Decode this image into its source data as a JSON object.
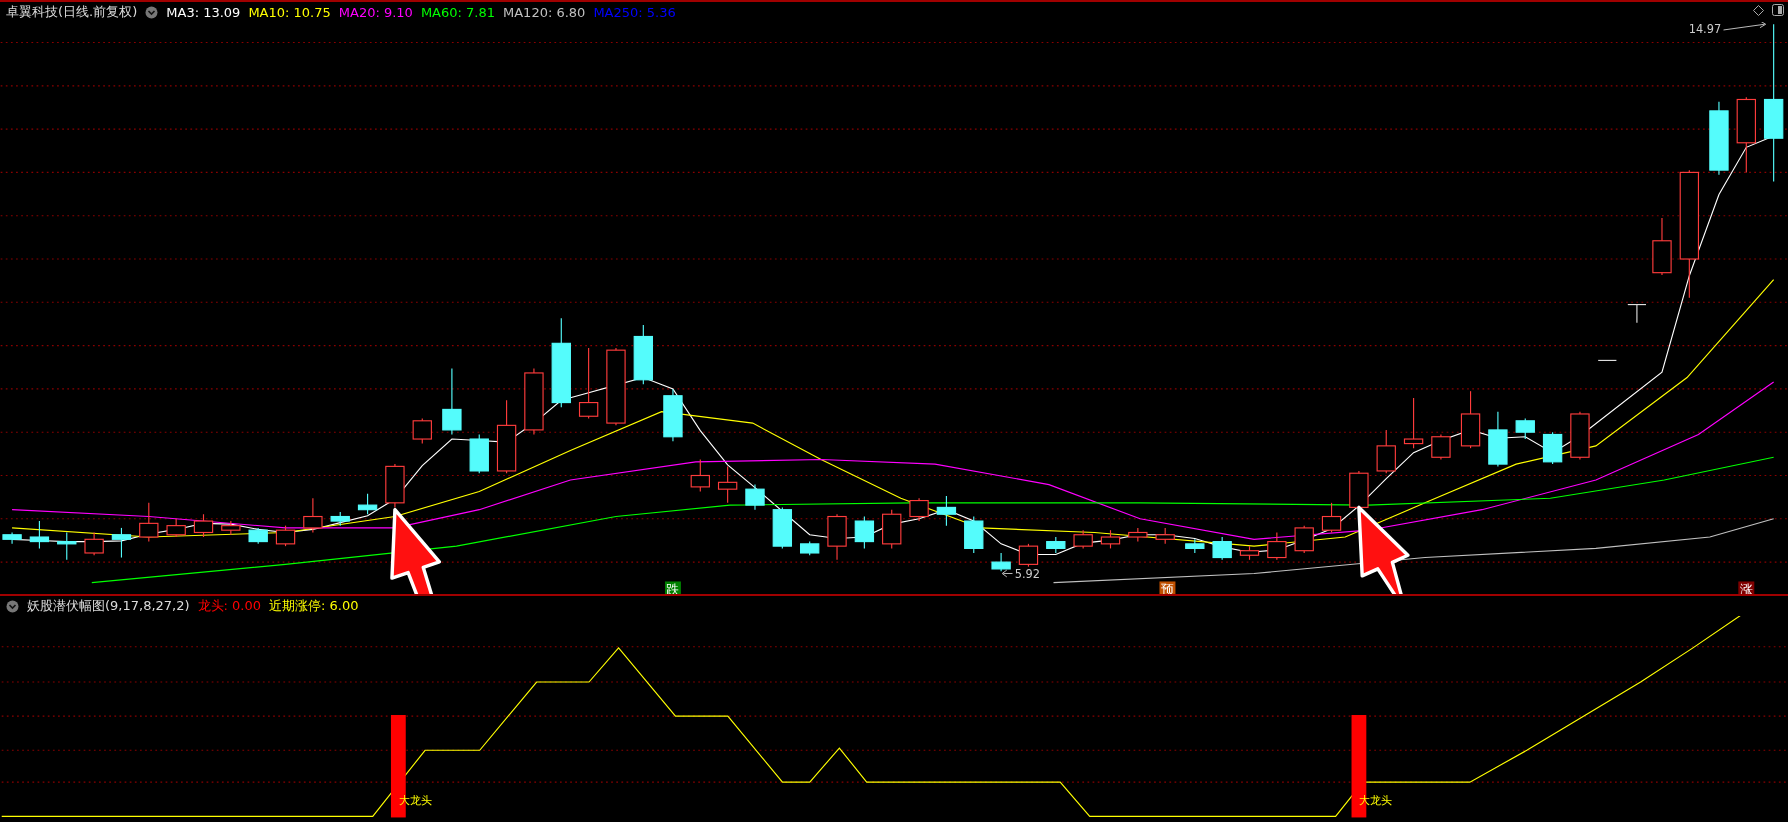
{
  "header": {
    "title": "卓翼科技(日线.前复权)",
    "averages": [
      {
        "label": "MA3: 13.09",
        "color": "#ffffff"
      },
      {
        "label": "MA10: 10.75",
        "color": "#ffff00"
      },
      {
        "label": "MA20: 9.10",
        "color": "#ff00ff"
      },
      {
        "label": "MA60: 7.81",
        "color": "#00ff00"
      },
      {
        "label": "MA120: 6.80",
        "color": "#c0c0c0"
      },
      {
        "label": "MA250: 5.36",
        "color": "#0000ff"
      }
    ]
  },
  "price_chart": {
    "high_label": "14.97",
    "low_label": "5.92",
    "markers": [
      {
        "text": "跌",
        "color": "#008000"
      },
      {
        "text": "预",
        "color": "#c05000"
      },
      {
        "text": "涨",
        "color": "#800000"
      }
    ]
  },
  "indicator": {
    "title": "妖股潜伏幅图(9,17,8,27,2)",
    "values": [
      {
        "label": "龙头: 0.00",
        "color": "#ff0000"
      },
      {
        "label": "近期涨停: 6.00",
        "color": "#ffff00"
      }
    ],
    "signals": [
      "大龙头",
      "大龙头"
    ]
  }
}
